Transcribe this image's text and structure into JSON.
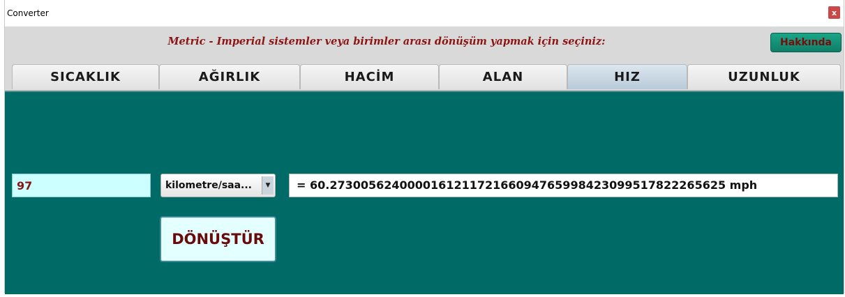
{
  "window": {
    "title": "Converter",
    "close_glyph": "x"
  },
  "header": {
    "subtitle": "Metric - Imperial sistemler veya birimler arası dönüşüm yapmak için seçiniz:",
    "about_label": "Hakkında"
  },
  "tabs": [
    {
      "label": "SICAKLIK",
      "active": false
    },
    {
      "label": "AĞIRLIK",
      "active": false
    },
    {
      "label": "HACİM",
      "active": false
    },
    {
      "label": "ALAN",
      "active": false
    },
    {
      "label": "HIZ",
      "active": true
    },
    {
      "label": "UZUNLUK",
      "active": false
    }
  ],
  "converter": {
    "input_value": "97",
    "unit_selected": "kilometre/saa...",
    "dropdown_icon": "dropdown-arrow-icon",
    "result": "= 60.273005624000016121172166094765998423099517822265625 mph",
    "convert_label": "DÖNÜŞTÜR"
  },
  "colors": {
    "content_background": "#006b66",
    "subtitle_text": "#8b1414",
    "about_button": "#16967c",
    "input_background": "#ccffff",
    "convert_button_text": "#6a0b0b",
    "active_tab": "#c8d8e4"
  }
}
